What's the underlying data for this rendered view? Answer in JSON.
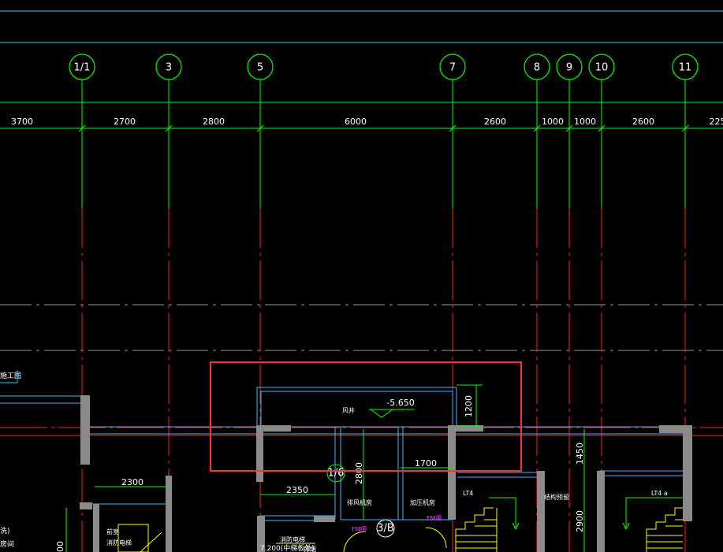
{
  "axes": [
    {
      "label": "1/1"
    },
    {
      "label": "3"
    },
    {
      "label": "5"
    },
    {
      "label": "7"
    },
    {
      "label": "8"
    },
    {
      "label": "9"
    },
    {
      "label": "10"
    },
    {
      "label": "11"
    }
  ],
  "dimensions": [
    "3700",
    "2700",
    "2800",
    "6000",
    "2600",
    "1000",
    "1000",
    "2600",
    "225"
  ],
  "annotations": {
    "elevation": "-5.650",
    "room_small": "风井",
    "dim_1200": "1200",
    "dim_1700": "1700",
    "dim_2800": "2800",
    "dim_2350": "2350",
    "dim_2300": "2300",
    "dim_1450": "1450",
    "dim_2900": "2900",
    "left_title": "施工图",
    "left_room": "房间",
    "left_room_prefix": "洗)",
    "bottom_note": "7.200(中梯板处)",
    "grid_bubble_small": "1/6",
    "grid_bubble_3b": "3/B",
    "door_fm1": "FM甲",
    "door_fm2": "FM甲",
    "stair_lt1": "LT4",
    "stair_lt2": "LT4 a",
    "room_a": "排风机房",
    "room_b": "加压机房",
    "room_c": "消防电梯",
    "room_d": "结构预留",
    "room_e": "前室",
    "room_f": "消防电梯",
    "room_g": "排烟",
    "left_num": "00"
  },
  "colors": {
    "background": "#000000",
    "axis_line": "#00ff00",
    "grid_red": "#ff2020",
    "wall_blue": "#3fb6ff",
    "column_gray": "#8a8a8a",
    "highlight_box": "#ff3030",
    "stair_yellow": "#ffff00",
    "label_magenta": "#ff33ff"
  }
}
